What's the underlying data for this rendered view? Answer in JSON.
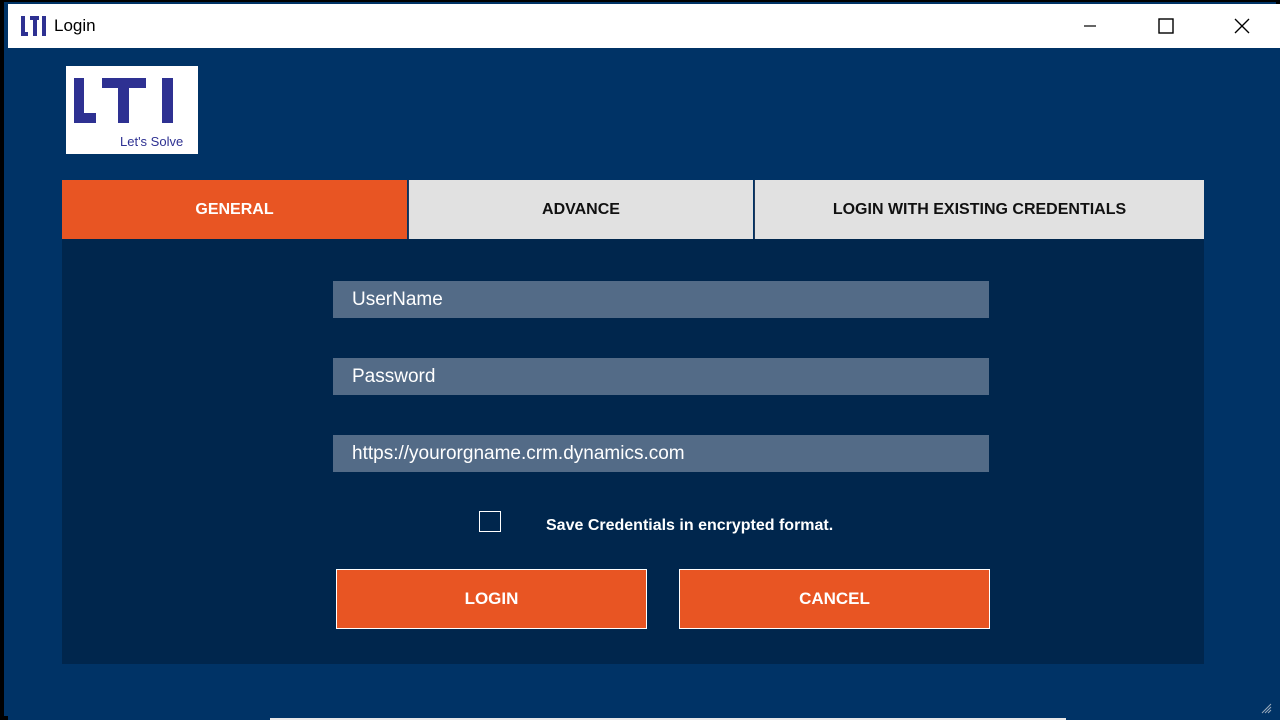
{
  "window": {
    "title": "Login",
    "title_icon": "lti-logo-icon",
    "controls": [
      "minimize-icon",
      "maximize-icon",
      "close-icon"
    ]
  },
  "logo": {
    "brand": "LTI",
    "tagline": "Let's Solve"
  },
  "tabs": [
    {
      "label": "GENERAL",
      "active": true
    },
    {
      "label": "ADVANCE",
      "active": false
    },
    {
      "label": "LOGIN WITH EXISTING CREDENTIALS",
      "active": false
    }
  ],
  "form": {
    "username_placeholder": "UserName",
    "password_placeholder": "Password",
    "url_placeholder": "https://yourorgname.crm.dynamics.com",
    "save_credentials_label": "Save Credentials in encrypted format.",
    "save_credentials_checked": false
  },
  "buttons": {
    "login": "LOGIN",
    "cancel": "CANCEL"
  },
  "colors": {
    "background": "#003366",
    "panel": "#00264d",
    "accent": "#e85523",
    "field": "#536b87",
    "tab_inactive": "#e1e1e1"
  }
}
